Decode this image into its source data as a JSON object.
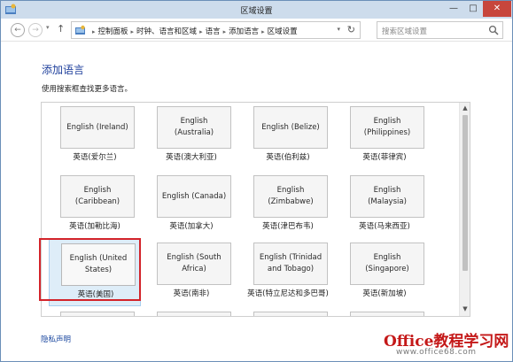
{
  "window": {
    "title": "区域设置",
    "close_glyph": "✕",
    "maximize_glyph": "□",
    "minimize_glyph": "—"
  },
  "nav": {
    "breadcrumbs": [
      "控制面板",
      "时钟、语言和区域",
      "语言",
      "添加语言",
      "区域设置"
    ],
    "search_placeholder": "搜索区域设置"
  },
  "page": {
    "title": "添加语言",
    "description": "使用搜索框查找更多语言。",
    "footer_link": "隐私声明"
  },
  "languages": [
    {
      "name": "English (Ireland)",
      "local": "英语(爱尔兰)",
      "selected": false
    },
    {
      "name": "English (Australia)",
      "local": "英语(澳大利亚)",
      "selected": false
    },
    {
      "name": "English (Belize)",
      "local": "英语(伯利兹)",
      "selected": false
    },
    {
      "name": "English (Philippines)",
      "local": "英语(菲律宾)",
      "selected": false
    },
    {
      "name": "English (Caribbean)",
      "local": "英语(加勒比海)",
      "selected": false
    },
    {
      "name": "English (Canada)",
      "local": "英语(加拿大)",
      "selected": false
    },
    {
      "name": "English (Zimbabwe)",
      "local": "英语(津巴布韦)",
      "selected": false
    },
    {
      "name": "English (Malaysia)",
      "local": "英语(马来西亚)",
      "selected": false
    },
    {
      "name": "English (United States)",
      "local": "英语(美国)",
      "selected": true
    },
    {
      "name": "English (South Africa)",
      "local": "英语(南非)",
      "selected": false
    },
    {
      "name": "English (Trinidad and Tobago)",
      "local": "英语(特立尼达和多巴哥)",
      "selected": false
    },
    {
      "name": "English (Singapore)",
      "local": "英语(新加坡)",
      "selected": false
    }
  ],
  "watermark": {
    "brand": "Office教程学习网",
    "url": "www.office68.com"
  },
  "colors": {
    "accent_title": "#1e3f9c",
    "selection_fill": "#deedf8",
    "highlight_border": "#d3232a",
    "close_button": "#c7463c"
  },
  "icons": {
    "app": "control-panel-icon",
    "back": "back-arrow-icon",
    "forward": "forward-arrow-icon",
    "up": "up-arrow-icon",
    "refresh": "refresh-icon",
    "search": "search-icon"
  }
}
